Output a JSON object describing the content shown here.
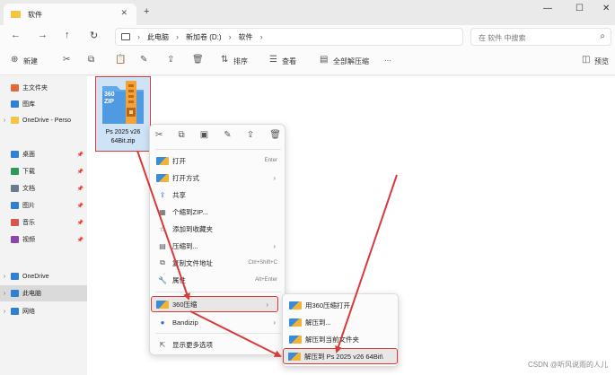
{
  "window": {
    "tab_title": "软件",
    "new_tab": "+",
    "tab_close": "✕",
    "minimize": "—",
    "maximize": "☐",
    "close": "✕"
  },
  "nav": {
    "back": "←",
    "forward": "→",
    "up": "↑",
    "refresh": "↻",
    "breadcrumb": [
      "此电脑",
      "新加卷 (D:)",
      "软件"
    ],
    "separator": "›",
    "search_placeholder": "在 软件 中搜索"
  },
  "toolbar": {
    "new_label": "新建",
    "sort_label": "排序",
    "view_label": "查看",
    "select_all_label": "全部解压缩",
    "more_label": "···",
    "preview_label": "预览"
  },
  "sidebar": {
    "items": [
      {
        "label": "主文件夹",
        "color": "#e06b3a"
      },
      {
        "label": "图库",
        "color": "#2f80d1"
      },
      {
        "label": "OneDrive - Perso",
        "color": "#f4c542"
      },
      {
        "label": "桌面",
        "color": "#2f80d1"
      },
      {
        "label": "下载",
        "color": "#2e9a5a"
      },
      {
        "label": "文档",
        "color": "#6b7a8f"
      },
      {
        "label": "图片",
        "color": "#2f80d1"
      },
      {
        "label": "音乐",
        "color": "#d9534f"
      },
      {
        "label": "视频",
        "color": "#8e44ad"
      },
      {
        "label": "OneDrive",
        "color": "#2f80d1"
      },
      {
        "label": "此电脑",
        "color": "#2f80d1"
      },
      {
        "label": "网络",
        "color": "#2f80d1"
      }
    ]
  },
  "file": {
    "name_line1": "Ps 2025 v26",
    "name_line2": "64Bit.zip",
    "icon_text_1": "360",
    "icon_text_2": "ZIP"
  },
  "context_menu": {
    "items": [
      {
        "label": "打开",
        "accel": "Enter",
        "icon": "open-icon"
      },
      {
        "label": "打开方式",
        "arrow": "›",
        "icon": "open-with-icon"
      },
      {
        "label": "共享",
        "icon": "share-icon"
      },
      {
        "label": "个缩到ZIP...",
        "icon": "zip-icon"
      },
      {
        "label": "添加到收藏夹",
        "icon": "star-icon"
      },
      {
        "label": "压缩到...",
        "arrow": "›",
        "icon": "compress-icon"
      },
      {
        "label": "复制文件地址",
        "accel": "Ctrl+Shift+C",
        "icon": "copy-path-icon"
      },
      {
        "label": "属性",
        "accel": "Alt+Enter",
        "icon": "wrench-icon"
      },
      {
        "label": "360压缩",
        "arrow": "›",
        "icon": "cube-icon"
      },
      {
        "label": "Bandizip",
        "arrow": "›",
        "icon": "bandizip-icon"
      },
      {
        "label": "显示更多选项",
        "icon": "more-options-icon"
      }
    ]
  },
  "submenu": {
    "items": [
      {
        "label": "用360压缩打开"
      },
      {
        "label": "解压到..."
      },
      {
        "label": "解压到当前文件夹"
      },
      {
        "label": "解压到 Ps 2025 v26 64Bit\\"
      }
    ]
  },
  "watermark": "CSDN @听风说雨的人儿",
  "colors": {
    "highlight": "#d93a3a",
    "selection": "#cfe3f7",
    "accent": "#2f80d1"
  }
}
